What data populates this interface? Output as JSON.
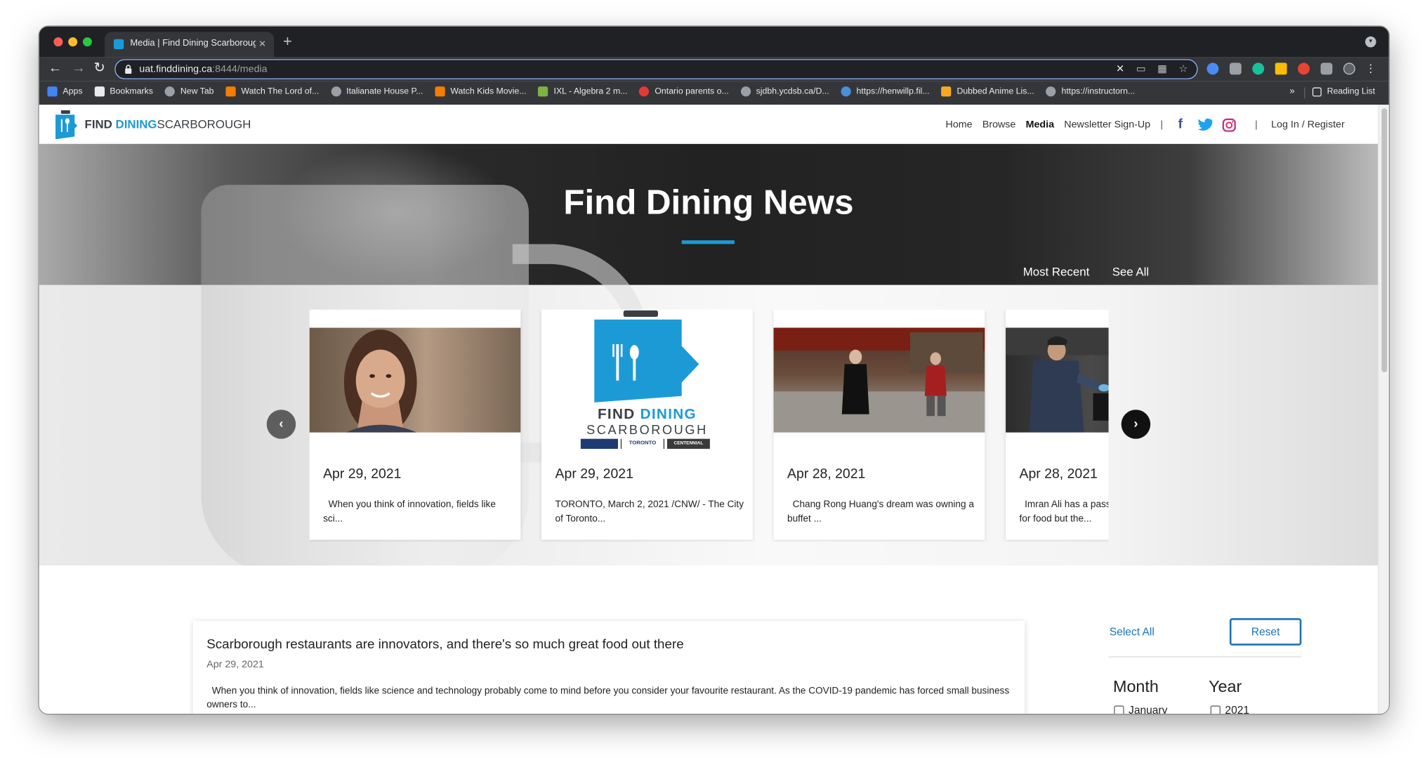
{
  "browser": {
    "tab_title": "Media | Find Dining Scarborough",
    "tab_close": "×",
    "new_tab": "+",
    "url_host": "uat.finddining.ca",
    "url_rest": ":8444/media",
    "back": "←",
    "forward": "→",
    "reload": "↻",
    "star": "☆",
    "more": "⋮",
    "bookmarks": [
      {
        "label": "Apps",
        "icon": "apps-grid-icon",
        "color": "#4285f4"
      },
      {
        "label": "Bookmarks",
        "icon": "star-icon",
        "color": "#e8eaed"
      },
      {
        "label": "New Tab",
        "icon": "globe-icon",
        "color": "#9aa0a6"
      },
      {
        "label": "Watch The Lord of...",
        "icon": "blogger-icon",
        "color": "#f57d00"
      },
      {
        "label": "Italianate House P...",
        "icon": "globe-icon",
        "color": "#9aa0a6"
      },
      {
        "label": "Watch Kids Movie...",
        "icon": "blogger-icon",
        "color": "#f57d00"
      },
      {
        "label": "IXL - Algebra 2 m...",
        "icon": "ixl-icon",
        "color": "#7cb342"
      },
      {
        "label": "Ontario parents o...",
        "icon": "maple-leaf-icon",
        "color": "#e53935"
      },
      {
        "label": "sjdbh.ycdsb.ca/D...",
        "icon": "globe-icon",
        "color": "#9aa0a6"
      },
      {
        "label": "https://henwillp.fil...",
        "icon": "wordpress-icon",
        "color": "#4a90d9"
      },
      {
        "label": "Dubbed Anime Lis...",
        "icon": "folder-icon",
        "color": "#f9a825"
      },
      {
        "label": "https://instructorn...",
        "icon": "globe-icon",
        "color": "#9aa0a6"
      }
    ],
    "bookmarks_more": "»",
    "reading_list": "Reading List"
  },
  "site": {
    "logo_find": "FIND",
    "logo_dining": "DINING",
    "logo_scarborough": "SCARBOROUGH",
    "nav": {
      "home": "Home",
      "browse": "Browse",
      "media": "Media",
      "newsletter": "Newsletter Sign-Up",
      "divider": "|",
      "login": "Log In / Register"
    },
    "social": {
      "facebook": "f",
      "twitter": "t",
      "instagram": "◎"
    },
    "colors": {
      "brand_blue": "#1c9ad6",
      "link_blue": "#1a73b8",
      "facebook": "#3b5998",
      "twitter": "#1da1f2",
      "instagram": "#c13584"
    }
  },
  "hero": {
    "title": "Find Dining News",
    "most_recent": "Most Recent",
    "see_all": "See All"
  },
  "carousel": {
    "prev": "‹",
    "next": "›",
    "cards": [
      {
        "date": "Apr 29, 2021",
        "excerpt": "  When you think of innovation, fields like sci..."
      },
      {
        "date": "Apr 29, 2021",
        "excerpt": "TORONTO, March 2, 2021 /CNW/ - The City of Toronto...",
        "logo_line1_a": "FIND",
        "logo_line1_b": "DINING",
        "logo_line2": "SCARBOROUGH",
        "partner_a": "TORONTO",
        "partner_b": "CENTENNIAL"
      },
      {
        "date": "Apr 28, 2021",
        "excerpt": "  Chang Rong Huang's dream was owning a buffet ..."
      },
      {
        "date": "Apr 28, 2021",
        "excerpt": "  Imran Ali has a passion for food but the..."
      }
    ]
  },
  "article": {
    "title": "Scarborough restaurants are innovators, and there's so much great food out there",
    "date": "Apr 29, 2021",
    "body": "  When you think of innovation, fields like science and technology probably come to mind before you consider your favourite restaurant. As the COVID-19 pandemic has forced small business owners to..."
  },
  "filters": {
    "select_all": "Select All",
    "reset": "Reset",
    "month_heading": "Month",
    "year_heading": "Year",
    "month_first": "January",
    "year_first": "2021"
  }
}
